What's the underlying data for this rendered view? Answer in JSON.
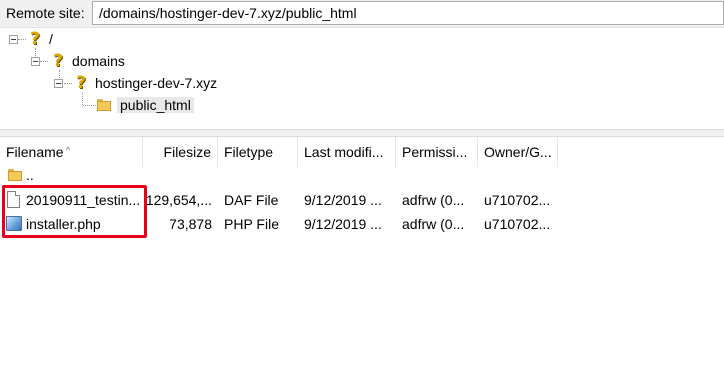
{
  "remote_site": {
    "label": "Remote site:",
    "path": "/domains/hostinger-dev-7.xyz/public_html"
  },
  "tree": {
    "nodes": [
      {
        "label": "/",
        "icon": "question-folder-icon"
      },
      {
        "label": "domains",
        "icon": "question-folder-icon"
      },
      {
        "label": "hostinger-dev-7.xyz",
        "icon": "question-folder-icon"
      },
      {
        "label": "public_html",
        "icon": "folder-icon"
      }
    ]
  },
  "columns": [
    "Filename",
    "Filesize",
    "Filetype",
    "Last modifi...",
    "Permissi...",
    "Owner/G..."
  ],
  "files": [
    {
      "name": "..",
      "size": "",
      "type": "",
      "modified": "",
      "perms": "",
      "owner": "",
      "icon": "folder-icon"
    },
    {
      "name": "20190911_testin...",
      "size": "129,654,...",
      "type": "DAF File",
      "modified": "9/12/2019 ...",
      "perms": "adfrw (0...",
      "owner": "u710702...",
      "icon": "file-icon"
    },
    {
      "name": "installer.php",
      "size": "73,878",
      "type": "PHP File",
      "modified": "9/12/2019 ...",
      "perms": "adfrw (0...",
      "owner": "u710702...",
      "icon": "php-file-icon"
    }
  ],
  "colors": {
    "highlight": "#e8001a",
    "selection": "#e8e8e8"
  }
}
